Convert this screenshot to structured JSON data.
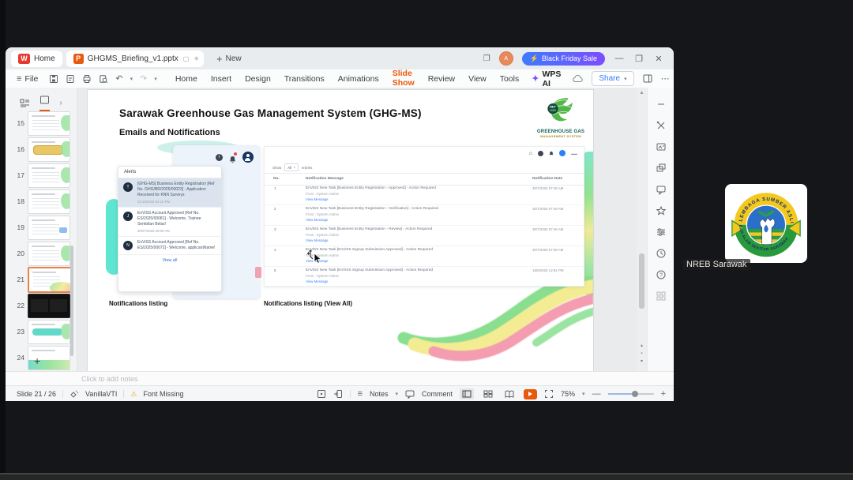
{
  "titlebar": {
    "home_tab": "Home",
    "doc_tab": "GHGMS_Briefing_v1.pptx",
    "new_label": "New",
    "promo": "Black Friday Sale"
  },
  "menubar": {
    "file": "File",
    "items": [
      "Home",
      "Insert",
      "Design",
      "Transitions",
      "Animations",
      "Slide Show",
      "Review",
      "View",
      "Tools"
    ],
    "wps_ai": "WPS AI",
    "share": "Share"
  },
  "thumbs": {
    "numbers": [
      "15",
      "16",
      "17",
      "18",
      "19",
      "20",
      "21",
      "22",
      "23",
      "24"
    ],
    "selected": "21"
  },
  "slide": {
    "title": "Sarawak Greenhouse Gas Management System (GHG-MS)",
    "subtitle": "Emails and Notifications",
    "logo": {
      "badge": "NET",
      "badge2": "2050",
      "name_line1": "GREENHOUSE GAS",
      "name_line2": "MANAGEMENT SYSTEM"
    },
    "alerts": {
      "header": "Alerts",
      "view_all": "View all",
      "items": [
        {
          "avatar": "T",
          "text": "[GHG-MS] Business Entity Registration [Ref No. GHG/BR/2025/00023] - Application Received for KNN Surveys",
          "time": "21/10/2025 02:19 PM"
        },
        {
          "avatar": "J",
          "text": "EnViSS Account Approved [Ref No. ES/2025/00081] - Welcome, Trainee Sembilan Belas!",
          "time": "30/07/2025 09:09 AM"
        },
        {
          "avatar": "N",
          "text": "EnViSS Account Approved [Ref No. ES/2025/00072] - Welcome, applicantName!",
          "time": ""
        }
      ]
    },
    "listing": {
      "show": "Show",
      "show_value": "All",
      "entries": "entries",
      "col_no": "No.",
      "col_message": "Notification Message",
      "col_date": "Notification Date",
      "rows": [
        {
          "no": "1",
          "message": "EnViSS New Task [Business Entity Registration - Approved] - Action Required",
          "from": "From : System Admin",
          "link": "View Message",
          "date": "30/7/2025 07:49 AM"
        },
        {
          "no": "2",
          "message": "EnViSS New Task [Business Entity Registration - Verification] - Action Required",
          "from": "From : System Admin",
          "link": "View Message",
          "date": "30/7/2025 07:49 AM"
        },
        {
          "no": "3",
          "message": "EnViSS New Task [Business Entity Registration - Review] - Action Required",
          "from": "From : System Admin",
          "link": "View Message",
          "date": "30/7/2025 07:46 AM"
        },
        {
          "no": "4",
          "message": "EnViSS New Task [EnViSS Signup Submission Approved] - Action Required",
          "from": "From : System Admin",
          "link": "View Message",
          "date": "30/7/2025 07:39 AM"
        },
        {
          "no": "5",
          "message": "EnViSS New Task [EnViSS Signup Submission Approved] - Action Required",
          "from": "From : System Admin",
          "link": "View Message",
          "date": "18/6/2025 12:51 PM"
        }
      ]
    },
    "caption_left": "Notifications listing",
    "caption_right": "Notifications listing (View All)"
  },
  "notes": {
    "placeholder": "Click to add notes"
  },
  "statusbar": {
    "slide_indicator": "Slide 21 / 26",
    "theme": "VanillaVTI",
    "font_warning": "Font Missing",
    "notes_label": "Notes",
    "comment_label": "Comment",
    "zoom": "75%"
  },
  "participant": {
    "name": "NREB Sarawak",
    "logo_arc_top": "LEMBAGA SUMBER ASLI",
    "logo_arc_bottom": "DAN ALAM SEKITAR SARAWAK"
  },
  "colors": {
    "accent_orange": "#e8590c",
    "promo_start": "#3f7bfd",
    "promo_end": "#7c4dff",
    "link_blue": "#3b82f6",
    "teal": "#5fe6d2",
    "wave_green": "#8ade8f",
    "wave_yellow": "#f3ec93",
    "wave_pink": "#f49cb0"
  }
}
